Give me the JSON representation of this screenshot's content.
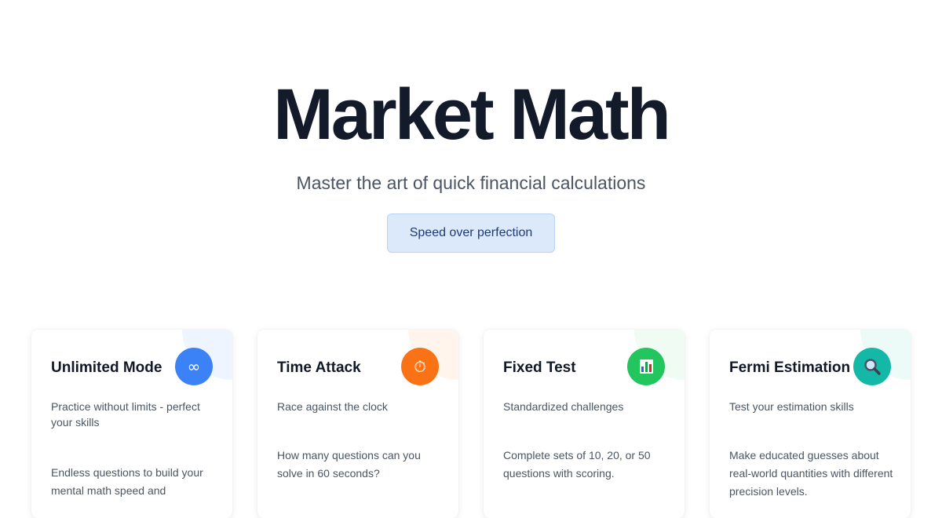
{
  "hero": {
    "title": "Market Math",
    "subtitle": "Master the art of quick financial calculations",
    "tagline": "Speed over perfection"
  },
  "colors": {
    "title": "#131b2b",
    "pill_bg": "#dbe9fb",
    "pill_text": "#1e3a78"
  },
  "modes": [
    {
      "title": "Unlimited Mode",
      "icon": "infinity-icon",
      "icon_glyph": "∞",
      "accent": "#3b82f6",
      "deco": "#eff5fe",
      "description": "Practice without limits - perfect your skills",
      "detail": "Endless questions to build your mental math speed and"
    },
    {
      "title": "Time Attack",
      "icon": "stopwatch-icon",
      "icon_glyph": "⏱",
      "accent": "#f97316",
      "deco": "#fff5ed",
      "description": "Race against the clock",
      "detail": "How many questions can you solve in 60 seconds?"
    },
    {
      "title": "Fixed Test",
      "icon": "bar-chart-icon",
      "icon_glyph": "▮",
      "accent": "#22c55e",
      "deco": "#effbf3",
      "description": "Standardized challenges",
      "detail": "Complete sets of 10, 20, or 50 questions with scoring."
    },
    {
      "title": "Fermi Estimation",
      "icon": "magnifier-icon",
      "icon_glyph": "⌕",
      "accent": "#14b8a6",
      "deco": "#edfbf8",
      "description": "Test your estimation skills",
      "detail": "Make educated guesses about real-world quantities with different precision levels."
    }
  ]
}
